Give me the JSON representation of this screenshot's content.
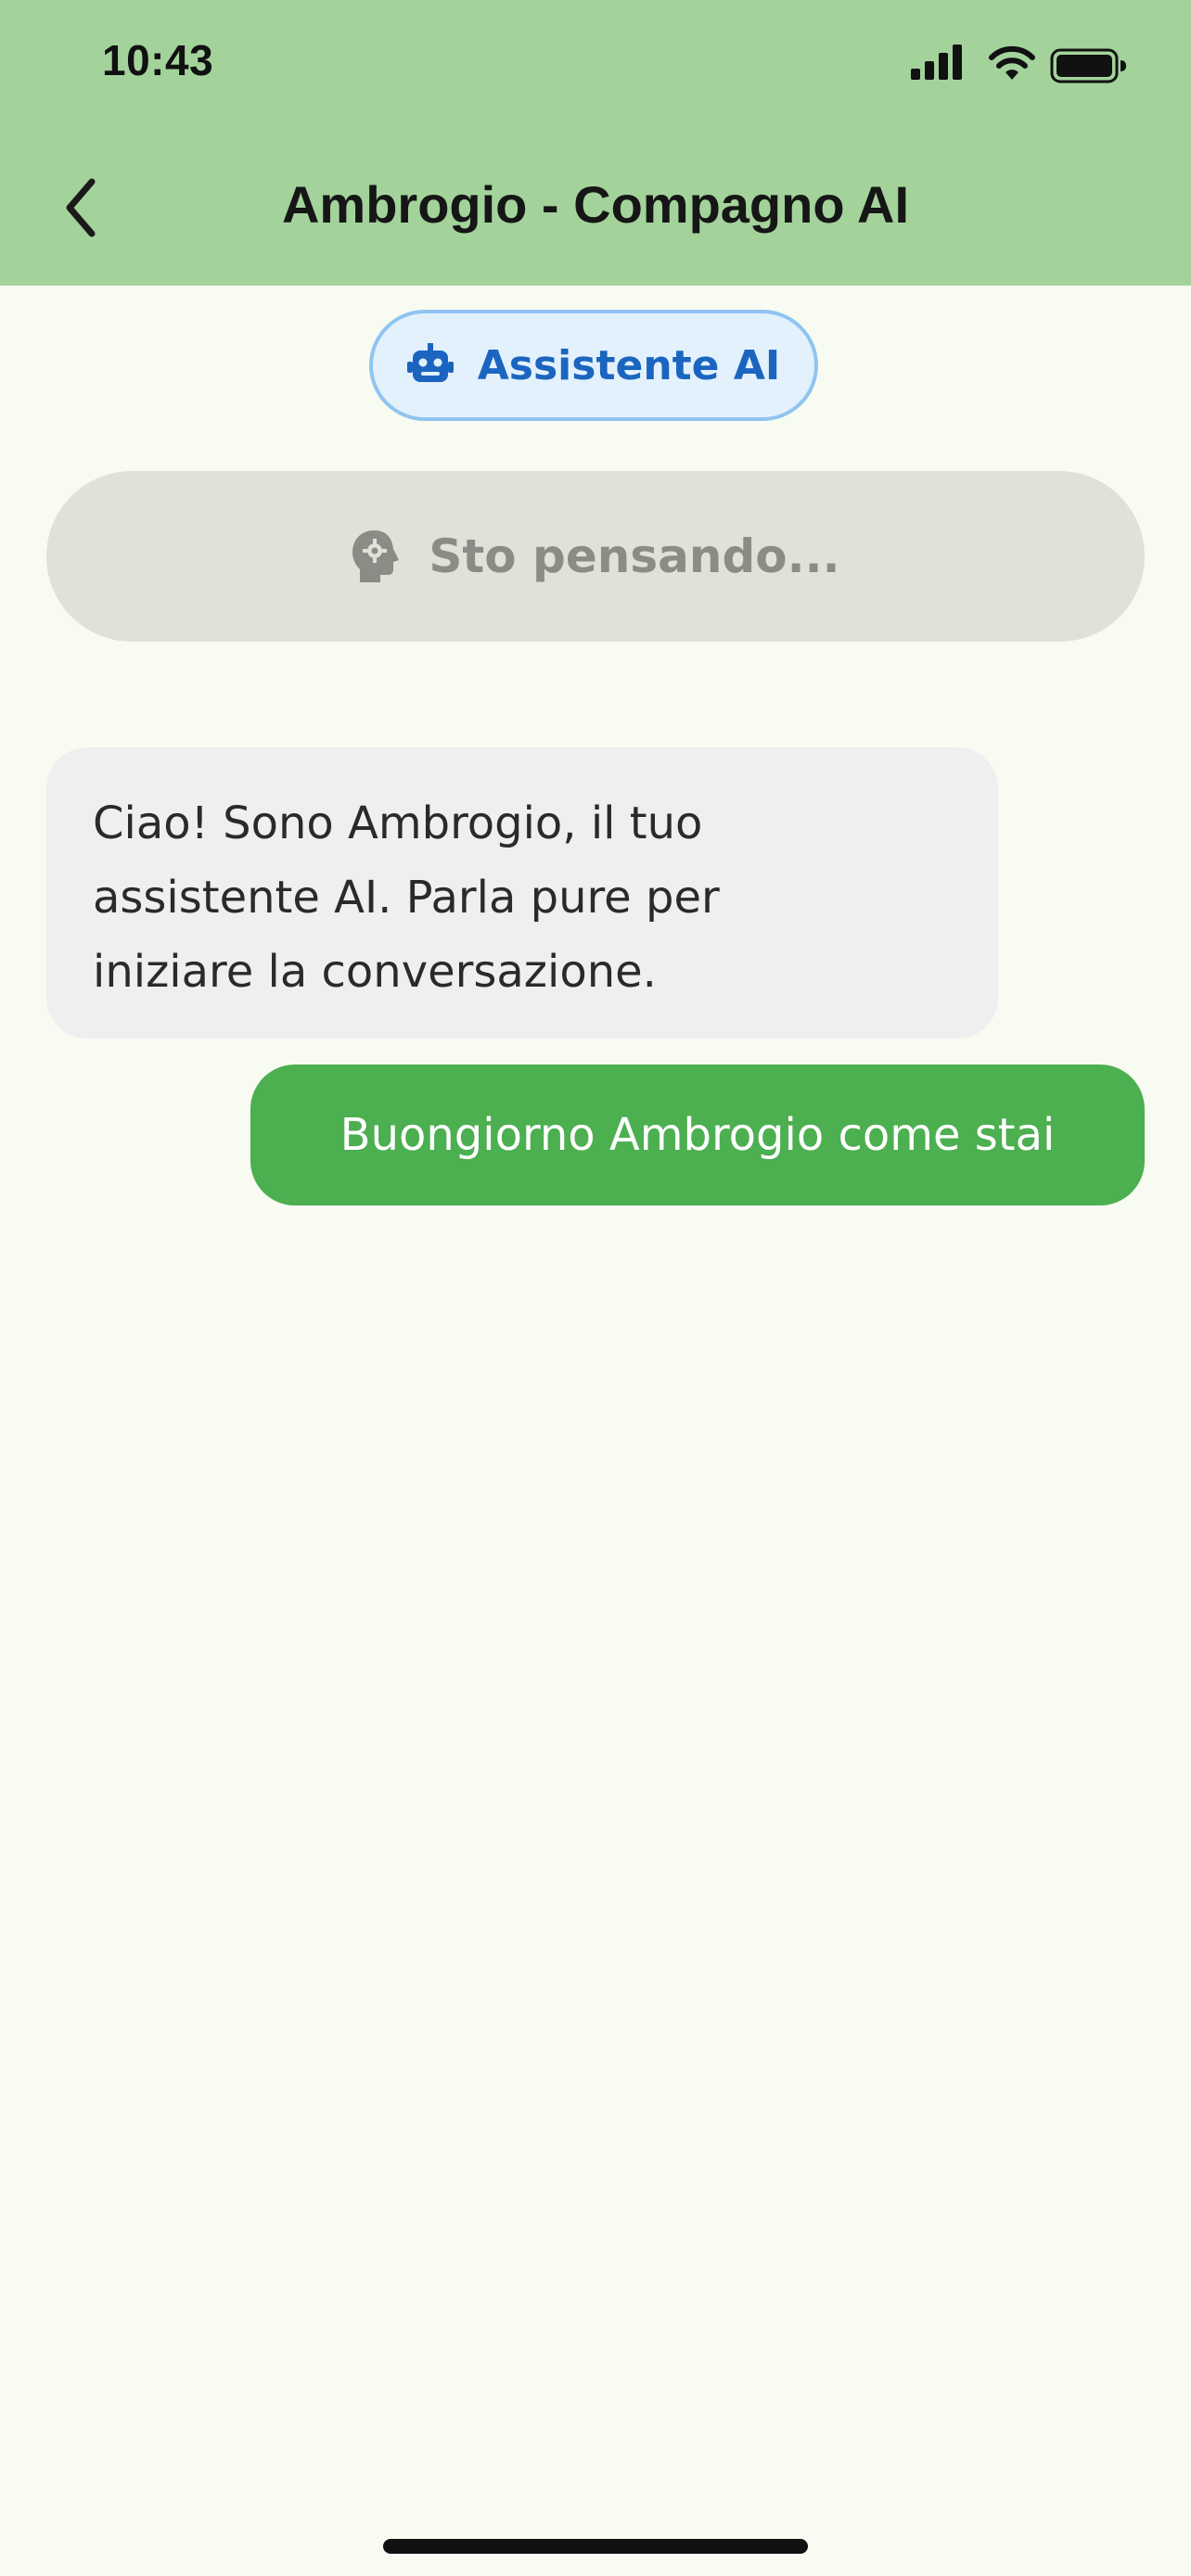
{
  "status_bar": {
    "time": "10:43",
    "icons": [
      "signal-icon",
      "wifi-icon",
      "battery-icon"
    ]
  },
  "app_bar": {
    "title": "Ambrogio - Compagno AI",
    "back_icon": "chevron-left-icon"
  },
  "mode_chip": {
    "label": "Assistente AI",
    "icon": "robot-icon"
  },
  "thinking": {
    "label": "Sto pensando...",
    "icon": "brain-head-icon"
  },
  "messages": [
    {
      "role": "assistant",
      "lines": [
        "Ciao! Sono Ambrogio, il tuo",
        "assistente AI. Parla pure per",
        "iniziare la conversazione."
      ]
    },
    {
      "role": "user",
      "text": "Buongiorno Ambrogio come stai"
    }
  ],
  "colors": {
    "header_bg": "#A3D39B",
    "page_bg": "#F8FBF2",
    "chip_bg": "#E3F1FD",
    "chip_border": "#90C4F0",
    "chip_text": "#1B65C0",
    "thinking_bg": "#DFE2D8",
    "thinking_text": "#8A8D86",
    "assistant_bubble": "#EFEFEF",
    "user_bubble": "#4CAF50"
  }
}
